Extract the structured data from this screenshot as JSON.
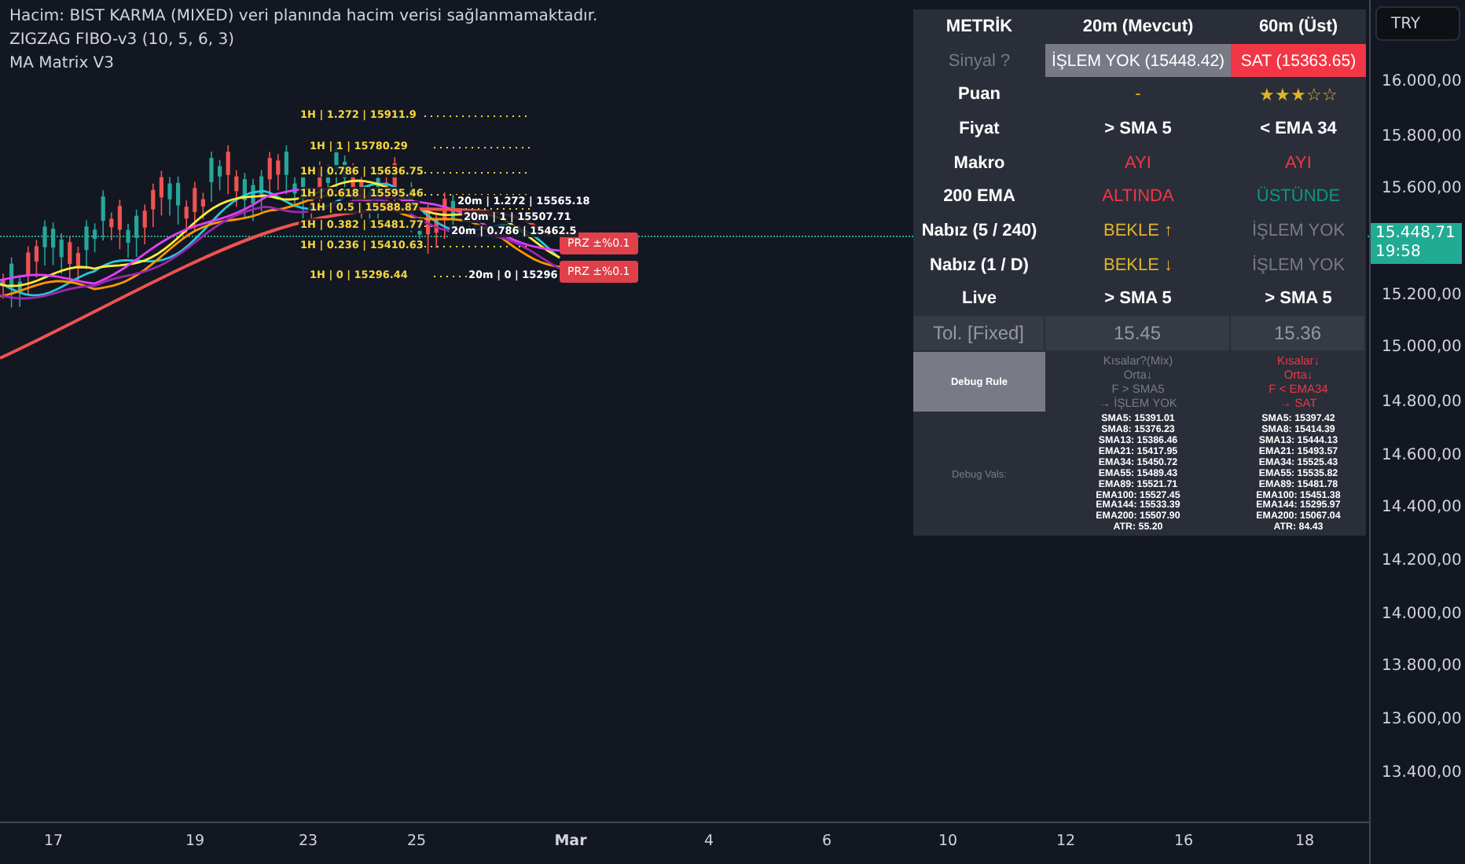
{
  "legend": [
    "Hacim: BIST KARMA (MIXED) veri planında hacim verisi sağlanmamaktadır.",
    "ZIGZAG FIBO-v3 (10, 5, 6, 3)",
    "MA Matrix V3"
  ],
  "fib_1h": [
    "1H | 1.272 | 15911.9",
    "1H | 1 | 15780.29",
    "1H | 0.786 | 15636.75",
    "1H | 0.618 | 15595.46",
    "1H | 0.5 | 15588.87",
    "1H | 0.382 | 15481.77",
    "1H | 0.236 | 15410.63",
    "1H | 0 | 15296.44"
  ],
  "fib_20m": [
    "20m | 1.272 | 15565.18",
    "20m | 1 | 15507.71",
    "20m | 0.786 | 15462.5",
    "20m | 0 | 15296"
  ],
  "prz_badges": [
    "PRZ ±%0.1",
    "PRZ ±%0.1"
  ],
  "table": {
    "header": [
      "METRİK",
      "20m (Mevcut)",
      "60m (Üst)"
    ],
    "rows": [
      {
        "label": "Sinyal ?",
        "kind": "muted",
        "cells": [
          {
            "text": "İŞLEM YOK (15448.42)",
            "kind": "neutral-signal"
          },
          {
            "text": "SAT (15363.65)",
            "kind": "sell-signal"
          }
        ]
      },
      {
        "label": "Puan",
        "kind": "plain",
        "cells": [
          {
            "text": "-",
            "kind": "wait"
          },
          {
            "text": "★★★☆☆",
            "kind": "wait"
          }
        ]
      },
      {
        "label": "Fiyat",
        "kind": "plain",
        "cells": [
          {
            "text": "> SMA 5",
            "kind": "plain"
          },
          {
            "text": "< EMA 34",
            "kind": "plain"
          }
        ]
      },
      {
        "label": "Makro",
        "kind": "plain",
        "cells": [
          {
            "text": "AYI",
            "kind": "bear"
          },
          {
            "text": "AYI",
            "kind": "bear"
          }
        ]
      },
      {
        "label": "200 EMA",
        "kind": "plain",
        "cells": [
          {
            "text": "ALTINDA",
            "kind": "bear"
          },
          {
            "text": "ÜSTÜNDE",
            "kind": "bull"
          }
        ]
      },
      {
        "label": "Nabız (5 / 240)",
        "kind": "plain",
        "cells": [
          {
            "text": "BEKLE ↑",
            "kind": "wait"
          },
          {
            "text": "İŞLEM YOK",
            "kind": "muted"
          }
        ]
      },
      {
        "label": "Nabız (1 / D)",
        "kind": "plain",
        "cells": [
          {
            "text": "BEKLE ↓",
            "kind": "wait"
          },
          {
            "text": "İŞLEM YOK",
            "kind": "muted"
          }
        ]
      },
      {
        "label": "Live",
        "kind": "plain",
        "cells": [
          {
            "text": "> SMA 5",
            "kind": "plain"
          },
          {
            "text": "> SMA 5",
            "kind": "plain"
          }
        ]
      }
    ],
    "tolerance": {
      "label": "Tol. [Fixed]",
      "values": [
        "15.45",
        "15.36"
      ]
    },
    "debug_rule": {
      "label": "Debug Rule",
      "cells": [
        {
          "lines": [
            "Kısalar?(Mix)",
            "Orta↓",
            "F > SMA5",
            "→ İŞLEM YOK"
          ],
          "kind": "muted"
        },
        {
          "lines": [
            "Kısalar↓",
            "Orta↓",
            "F < EMA34",
            "→ SAT"
          ],
          "kind": "bear"
        }
      ]
    },
    "debug_vals": {
      "label": "Debug Vals:",
      "cells": [
        [
          "SMA5: 15391.01",
          "SMA8: 15376.23",
          "SMA13: 15386.46",
          "EMA21: 15417.95",
          "EMA34: 15450.72",
          "EMA55: 15489.43",
          "EMA89: 15521.71",
          "EMA100: 15527.45",
          "EMA144: 15533.39",
          "EMA200: 15507.90",
          "ATR: 55.20"
        ],
        [
          "SMA5: 15397.42",
          "SMA8: 15414.39",
          "SMA13: 15444.13",
          "EMA21: 15493.57",
          "EMA34: 15525.43",
          "EMA55: 15535.82",
          "EMA89: 15481.78",
          "EMA100: 15451.38",
          "EMA144: 15295.97",
          "EMA200: 15067.04",
          "ATR: 84.43"
        ]
      ]
    }
  },
  "currency": "TRY",
  "price_axis": [
    "16.000,00",
    "15.800,00",
    "15.600,00",
    "15.200,00",
    "15.000,00",
    "14.800,00",
    "14.600,00",
    "14.400,00",
    "14.200,00",
    "14.000,00",
    "13.800,00",
    "13.600,00",
    "13.400,00"
  ],
  "current_price": {
    "price": "15.448,71",
    "countdown": "19:58"
  },
  "time_axis": [
    "17",
    "19",
    "23",
    "25",
    "Mar",
    "4",
    "6",
    "10",
    "12",
    "16",
    "18"
  ]
}
